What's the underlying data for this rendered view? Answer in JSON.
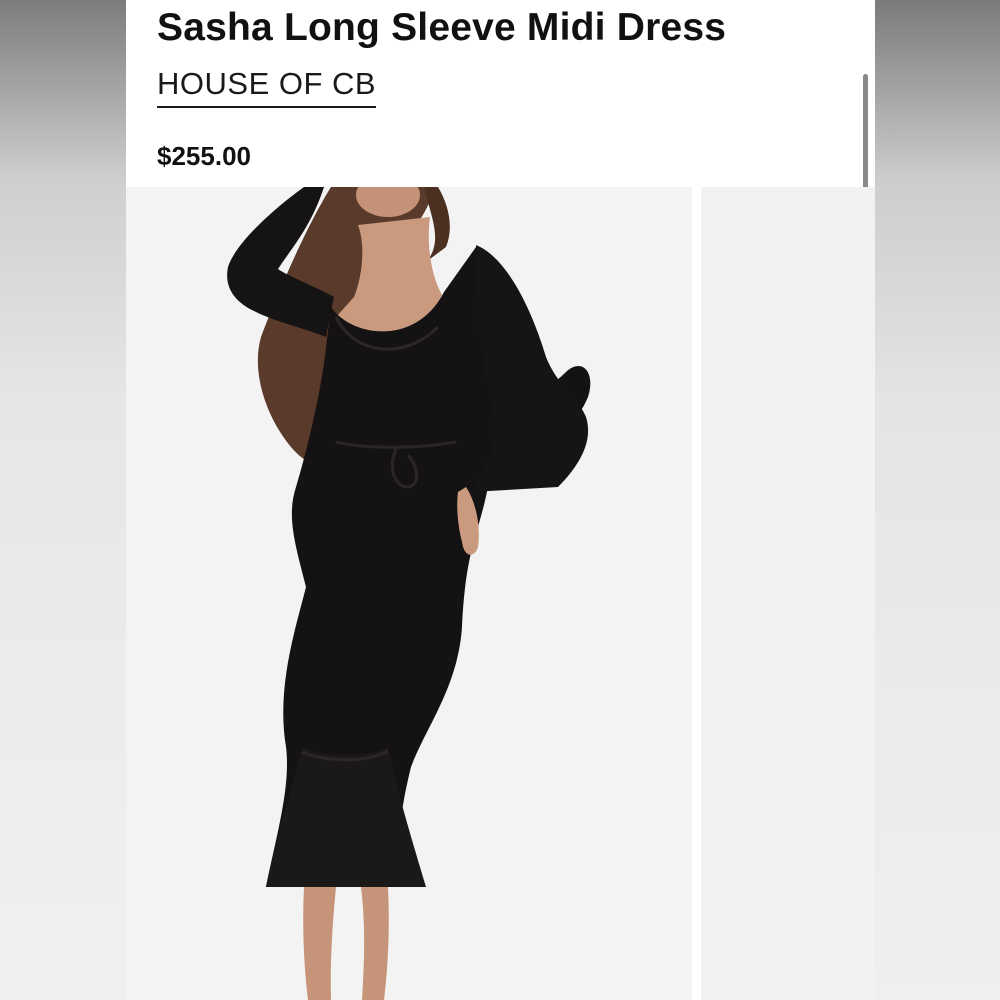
{
  "product": {
    "title": "Sasha Long Sleeve Midi Dress",
    "brand": "HOUSE OF CB",
    "price": "$255.00"
  },
  "gallery": {
    "images": [
      {
        "subject": "model-in-black-long-sleeve-midi-dress"
      },
      {
        "subject": "next-product-image"
      }
    ]
  },
  "colors": {
    "text": "#111111",
    "dress": "#141212",
    "image_background": "#f4f3f3"
  }
}
